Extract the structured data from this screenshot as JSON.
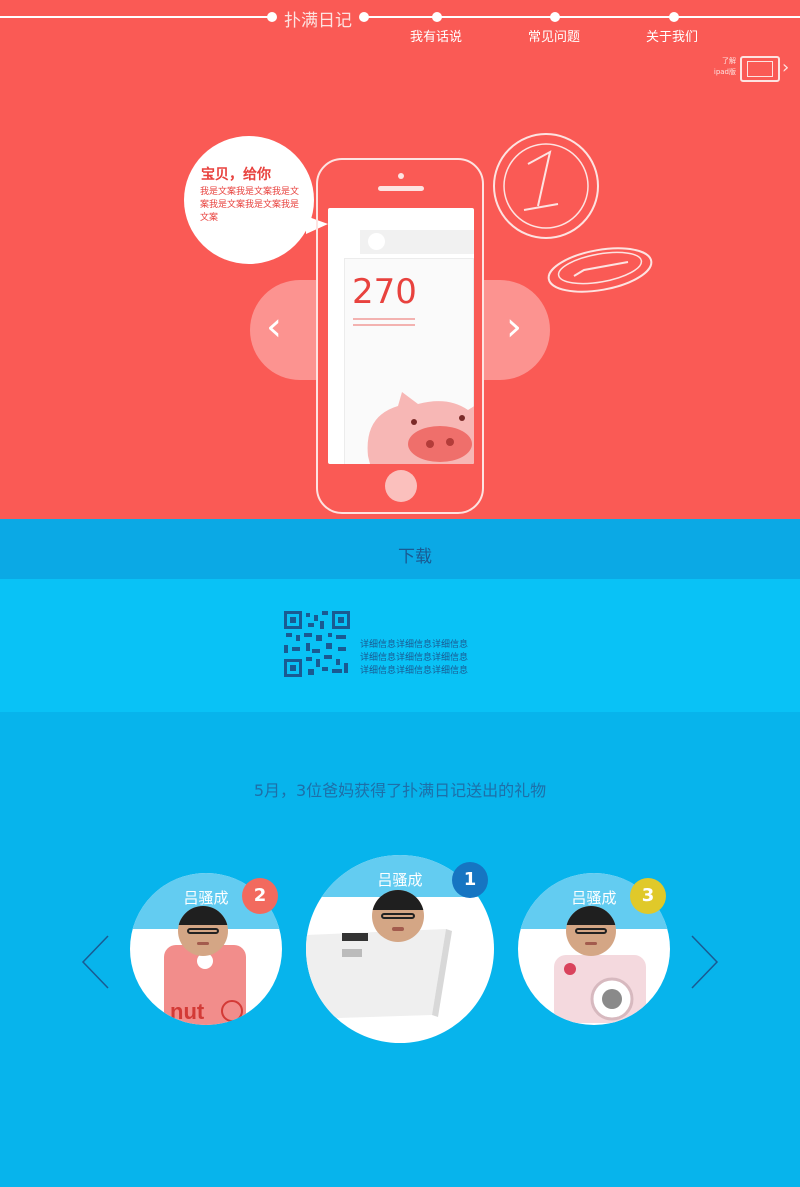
{
  "header": {
    "brand": "扑满日记",
    "nav": [
      "我有话说",
      "常见问题",
      "关于我们"
    ],
    "ipad_line1": "了解",
    "ipad_line2": "ipad版"
  },
  "hero": {
    "bubble_title": "宝贝，给你",
    "bubble_text": "我是文案我是文案我是文案我是文案我是文案我是文案",
    "screen_number": "270"
  },
  "download": {
    "label": "下载",
    "details": [
      "详细信息详细信息详细信息",
      "详细信息详细信息详细信息",
      "详细信息详细信息详细信息"
    ]
  },
  "gifts": {
    "heading": "5月，3位爸妈获得了扑满日记送出的礼物",
    "winners": [
      {
        "name": "吕骚成",
        "rank": "2",
        "rank_color": "#f26a5e"
      },
      {
        "name": "吕骚成",
        "rank": "1",
        "rank_color": "#1675c2"
      },
      {
        "name": "吕骚成",
        "rank": "3",
        "rank_color": "#e0c92a"
      }
    ]
  },
  "colors": {
    "hero": "#fa5a55",
    "download_bar": "#0ba9e5",
    "qr_band": "#09c2f6",
    "bottom": "#07b4ec"
  }
}
